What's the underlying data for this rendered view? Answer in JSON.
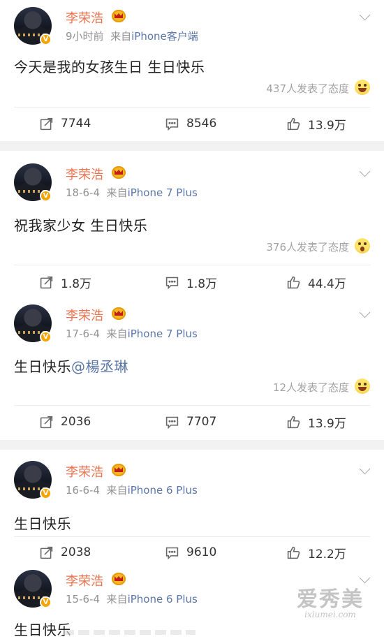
{
  "colors": {
    "name": "#eb7350",
    "link": "#5b77a8",
    "meta": "#929292",
    "verified": "#f7a300",
    "crown": "#f6b81f"
  },
  "posts": [
    {
      "author": "李荣浩",
      "time": "9小时前",
      "source_prefix": "来自",
      "source": "iPhone客户端",
      "text": "今天是我的女孩生日 生日快乐",
      "mention": "",
      "reactions": "437人发表了态度",
      "reaction_emoji": "laugh-emoji",
      "reposts": "7744",
      "comments": "8546",
      "likes": "13.9万"
    },
    {
      "author": "李荣浩",
      "time": "18-6-4",
      "source_prefix": "来自",
      "source": "iPhone 7 Plus",
      "text": "祝我家少女 生日快乐",
      "mention": "",
      "reactions": "376人发表了态度",
      "reaction_emoji": "surprise-emoji",
      "reposts": "1.8万",
      "comments": "1.8万",
      "likes": "44.4万"
    },
    {
      "author": "李荣浩",
      "time": "17-6-4",
      "source_prefix": "来自",
      "source": "iPhone 7 Plus",
      "text": "生日快乐",
      "mention": "@楊丞琳",
      "reactions": "12人发表了态度",
      "reaction_emoji": "laugh-emoji",
      "reposts": "2036",
      "comments": "7707",
      "likes": "13.9万"
    },
    {
      "author": "李荣浩",
      "time": "16-6-4",
      "source_prefix": "来自",
      "source": "iPhone 6 Plus",
      "text": "生日快乐",
      "mention": "",
      "reposts": "2038",
      "comments": "9610",
      "likes": "12.2万"
    },
    {
      "author": "李荣浩",
      "time": "15-6-4",
      "source_prefix": "来自",
      "source": "iPhone 6 Plus",
      "text": "生日快乐",
      "mention": ""
    }
  ],
  "verified_badge": "V",
  "watermark": {
    "main": "爱秀美",
    "url": "ixiumei.com"
  }
}
